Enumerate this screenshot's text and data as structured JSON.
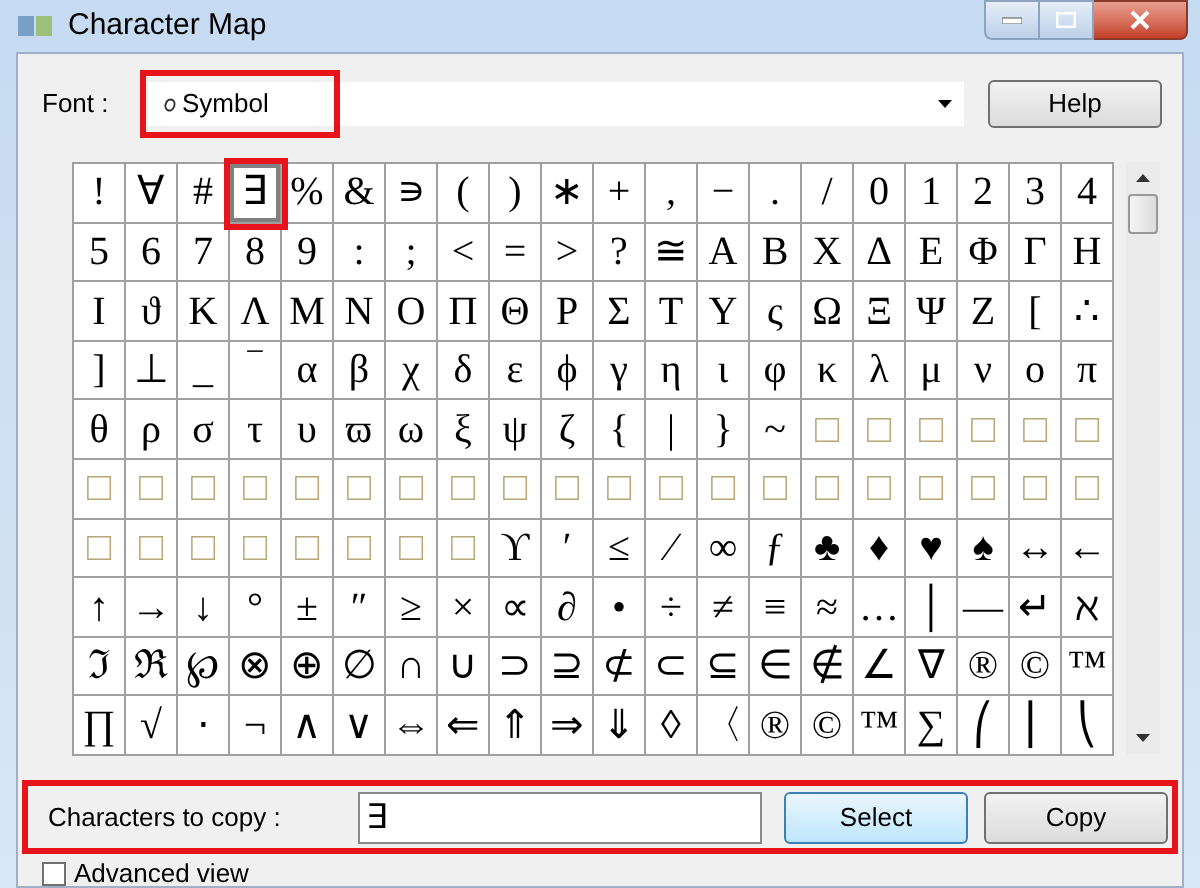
{
  "window": {
    "title": "Character Map"
  },
  "font": {
    "label": "Font :",
    "value": "Symbol",
    "highlighted": true
  },
  "help_button": "Help",
  "grid": {
    "rows": [
      [
        {
          "c": "!",
          "selected": false
        },
        {
          "c": "∀",
          "selected": false
        },
        {
          "c": "#",
          "selected": false
        },
        {
          "c": "∃",
          "selected": true,
          "highlighted": true
        },
        {
          "c": "%",
          "selected": false
        },
        {
          "c": "&",
          "selected": false
        },
        {
          "c": "∍",
          "selected": false
        },
        {
          "c": "(",
          "selected": false
        },
        {
          "c": ")",
          "selected": false
        },
        {
          "c": "∗",
          "selected": false
        },
        {
          "c": "+",
          "selected": false
        },
        {
          "c": ",",
          "selected": false
        },
        {
          "c": "−",
          "selected": false
        },
        {
          "c": ".",
          "selected": false
        },
        {
          "c": "/",
          "selected": false
        },
        {
          "c": "0",
          "selected": false
        },
        {
          "c": "1",
          "selected": false
        },
        {
          "c": "2",
          "selected": false
        },
        {
          "c": "3",
          "selected": false
        },
        {
          "c": "4",
          "selected": false
        }
      ],
      [
        {
          "c": "5",
          "selected": false
        },
        {
          "c": "6",
          "selected": false
        },
        {
          "c": "7",
          "selected": false
        },
        {
          "c": "8",
          "selected": false
        },
        {
          "c": "9",
          "selected": false
        },
        {
          "c": ":",
          "selected": false
        },
        {
          "c": ";",
          "selected": false
        },
        {
          "c": "<",
          "selected": false
        },
        {
          "c": "=",
          "selected": false
        },
        {
          "c": ">",
          "selected": false
        },
        {
          "c": "?",
          "selected": false
        },
        {
          "c": "≅",
          "selected": false
        },
        {
          "c": "Α",
          "selected": false
        },
        {
          "c": "Β",
          "selected": false
        },
        {
          "c": "Χ",
          "selected": false
        },
        {
          "c": "Δ",
          "selected": false
        },
        {
          "c": "Ε",
          "selected": false
        },
        {
          "c": "Φ",
          "selected": false
        },
        {
          "c": "Γ",
          "selected": false
        },
        {
          "c": "Η",
          "selected": false
        }
      ],
      [
        {
          "c": "Ι",
          "selected": false
        },
        {
          "c": "ϑ",
          "selected": false
        },
        {
          "c": "Κ",
          "selected": false
        },
        {
          "c": "Λ",
          "selected": false
        },
        {
          "c": "Μ",
          "selected": false
        },
        {
          "c": "Ν",
          "selected": false
        },
        {
          "c": "Ο",
          "selected": false
        },
        {
          "c": "Π",
          "selected": false
        },
        {
          "c": "Θ",
          "selected": false
        },
        {
          "c": "Ρ",
          "selected": false
        },
        {
          "c": "Σ",
          "selected": false
        },
        {
          "c": "Τ",
          "selected": false
        },
        {
          "c": "Υ",
          "selected": false
        },
        {
          "c": "ς",
          "selected": false
        },
        {
          "c": "Ω",
          "selected": false
        },
        {
          "c": "Ξ",
          "selected": false
        },
        {
          "c": "Ψ",
          "selected": false
        },
        {
          "c": "Ζ",
          "selected": false
        },
        {
          "c": "[",
          "selected": false
        },
        {
          "c": "∴",
          "selected": false
        }
      ],
      [
        {
          "c": "]",
          "selected": false
        },
        {
          "c": "⊥",
          "selected": false
        },
        {
          "c": "_",
          "selected": false
        },
        {
          "c": "‾",
          "selected": false
        },
        {
          "c": "α",
          "selected": false
        },
        {
          "c": "β",
          "selected": false
        },
        {
          "c": "χ",
          "selected": false
        },
        {
          "c": "δ",
          "selected": false
        },
        {
          "c": "ε",
          "selected": false
        },
        {
          "c": "ϕ",
          "selected": false
        },
        {
          "c": "γ",
          "selected": false
        },
        {
          "c": "η",
          "selected": false
        },
        {
          "c": "ι",
          "selected": false
        },
        {
          "c": "φ",
          "selected": false
        },
        {
          "c": "κ",
          "selected": false
        },
        {
          "c": "λ",
          "selected": false
        },
        {
          "c": "μ",
          "selected": false
        },
        {
          "c": "ν",
          "selected": false
        },
        {
          "c": "ο",
          "selected": false
        },
        {
          "c": "π",
          "selected": false
        }
      ],
      [
        {
          "c": "θ",
          "selected": false
        },
        {
          "c": "ρ",
          "selected": false
        },
        {
          "c": "σ",
          "selected": false
        },
        {
          "c": "τ",
          "selected": false
        },
        {
          "c": "υ",
          "selected": false
        },
        {
          "c": "ϖ",
          "selected": false
        },
        {
          "c": "ω",
          "selected": false
        },
        {
          "c": "ξ",
          "selected": false
        },
        {
          "c": "ψ",
          "selected": false
        },
        {
          "c": "ζ",
          "selected": false
        },
        {
          "c": "{",
          "selected": false
        },
        {
          "c": "|",
          "selected": false
        },
        {
          "c": "}",
          "selected": false
        },
        {
          "c": "~",
          "selected": false
        },
        {
          "c": "□",
          "selected": false
        },
        {
          "c": "□",
          "selected": false
        },
        {
          "c": "□",
          "selected": false
        },
        {
          "c": "□",
          "selected": false
        },
        {
          "c": "□",
          "selected": false
        },
        {
          "c": "□",
          "selected": false
        }
      ],
      [
        {
          "c": "□",
          "selected": false
        },
        {
          "c": "□",
          "selected": false
        },
        {
          "c": "□",
          "selected": false
        },
        {
          "c": "□",
          "selected": false
        },
        {
          "c": "□",
          "selected": false
        },
        {
          "c": "□",
          "selected": false
        },
        {
          "c": "□",
          "selected": false
        },
        {
          "c": "□",
          "selected": false
        },
        {
          "c": "□",
          "selected": false
        },
        {
          "c": "□",
          "selected": false
        },
        {
          "c": "□",
          "selected": false
        },
        {
          "c": "□",
          "selected": false
        },
        {
          "c": "□",
          "selected": false
        },
        {
          "c": "□",
          "selected": false
        },
        {
          "c": "□",
          "selected": false
        },
        {
          "c": "□",
          "selected": false
        },
        {
          "c": "□",
          "selected": false
        },
        {
          "c": "□",
          "selected": false
        },
        {
          "c": "□",
          "selected": false
        },
        {
          "c": "□",
          "selected": false
        }
      ],
      [
        {
          "c": "□",
          "selected": false
        },
        {
          "c": "□",
          "selected": false
        },
        {
          "c": "□",
          "selected": false
        },
        {
          "c": "□",
          "selected": false
        },
        {
          "c": "□",
          "selected": false
        },
        {
          "c": "□",
          "selected": false
        },
        {
          "c": "□",
          "selected": false
        },
        {
          "c": "□",
          "selected": false
        },
        {
          "c": "ϒ",
          "selected": false
        },
        {
          "c": "′",
          "selected": false
        },
        {
          "c": "≤",
          "selected": false
        },
        {
          "c": "⁄",
          "selected": false
        },
        {
          "c": "∞",
          "selected": false
        },
        {
          "c": "ƒ",
          "selected": false
        },
        {
          "c": "♣",
          "selected": false
        },
        {
          "c": "♦",
          "selected": false
        },
        {
          "c": "♥",
          "selected": false
        },
        {
          "c": "♠",
          "selected": false
        },
        {
          "c": "↔",
          "selected": false
        },
        {
          "c": "←",
          "selected": false
        }
      ],
      [
        {
          "c": "↑",
          "selected": false
        },
        {
          "c": "→",
          "selected": false
        },
        {
          "c": "↓",
          "selected": false
        },
        {
          "c": "°",
          "selected": false
        },
        {
          "c": "±",
          "selected": false
        },
        {
          "c": "″",
          "selected": false
        },
        {
          "c": "≥",
          "selected": false
        },
        {
          "c": "×",
          "selected": false
        },
        {
          "c": "∝",
          "selected": false
        },
        {
          "c": "∂",
          "selected": false
        },
        {
          "c": "•",
          "selected": false
        },
        {
          "c": "÷",
          "selected": false
        },
        {
          "c": "≠",
          "selected": false
        },
        {
          "c": "≡",
          "selected": false
        },
        {
          "c": "≈",
          "selected": false
        },
        {
          "c": "…",
          "selected": false
        },
        {
          "c": "│",
          "selected": false
        },
        {
          "c": "—",
          "selected": false
        },
        {
          "c": "↵",
          "selected": false
        },
        {
          "c": "ℵ",
          "selected": false
        }
      ],
      [
        {
          "c": "ℑ",
          "selected": false
        },
        {
          "c": "ℜ",
          "selected": false
        },
        {
          "c": "℘",
          "selected": false
        },
        {
          "c": "⊗",
          "selected": false
        },
        {
          "c": "⊕",
          "selected": false
        },
        {
          "c": "∅",
          "selected": false
        },
        {
          "c": "∩",
          "selected": false
        },
        {
          "c": "∪",
          "selected": false
        },
        {
          "c": "⊃",
          "selected": false
        },
        {
          "c": "⊇",
          "selected": false
        },
        {
          "c": "⊄",
          "selected": false
        },
        {
          "c": "⊂",
          "selected": false
        },
        {
          "c": "⊆",
          "selected": false
        },
        {
          "c": "∈",
          "selected": false
        },
        {
          "c": "∉",
          "selected": false
        },
        {
          "c": "∠",
          "selected": false
        },
        {
          "c": "∇",
          "selected": false
        },
        {
          "c": "®",
          "selected": false
        },
        {
          "c": "©",
          "selected": false
        },
        {
          "c": "™",
          "selected": false
        }
      ],
      [
        {
          "c": "∏",
          "selected": false
        },
        {
          "c": "√",
          "selected": false
        },
        {
          "c": "⋅",
          "selected": false
        },
        {
          "c": "¬",
          "selected": false
        },
        {
          "c": "∧",
          "selected": false
        },
        {
          "c": "∨",
          "selected": false
        },
        {
          "c": "⇔",
          "selected": false
        },
        {
          "c": "⇐",
          "selected": false
        },
        {
          "c": "⇑",
          "selected": false
        },
        {
          "c": "⇒",
          "selected": false
        },
        {
          "c": "⇓",
          "selected": false
        },
        {
          "c": "◊",
          "selected": false
        },
        {
          "c": "〈",
          "selected": false
        },
        {
          "c": "®",
          "selected": false
        },
        {
          "c": "©",
          "selected": false
        },
        {
          "c": "™",
          "selected": false
        },
        {
          "c": "∑",
          "selected": false
        },
        {
          "c": "⎛",
          "selected": false
        },
        {
          "c": "⎜",
          "selected": false
        },
        {
          "c": "⎝",
          "selected": false
        }
      ]
    ]
  },
  "copy": {
    "label": "Characters to copy :",
    "value": "∃",
    "highlighted": true
  },
  "select_button": "Select",
  "copy_button": "Copy",
  "advanced_view": {
    "label": "Advanced view",
    "checked": false
  }
}
